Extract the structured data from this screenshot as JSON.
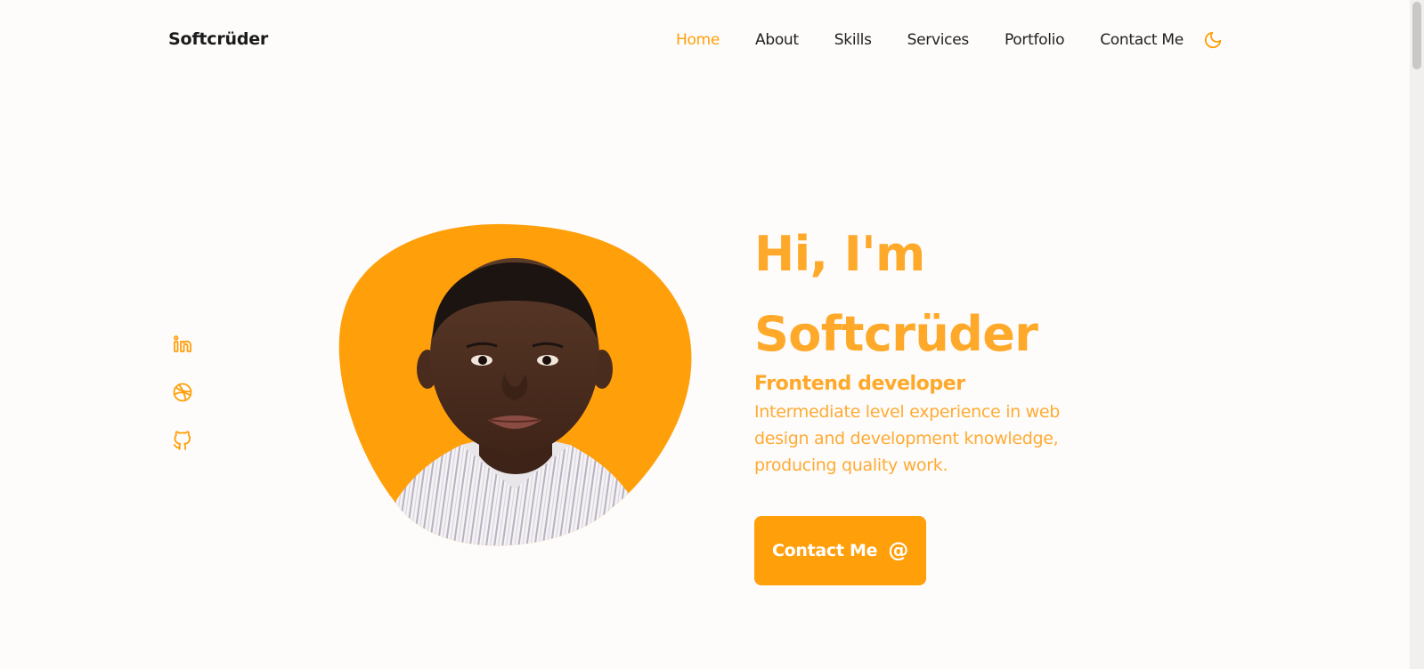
{
  "brand": "Softcrüder",
  "nav": {
    "items": [
      "Home",
      "About",
      "Skills",
      "Services",
      "Portfolio",
      "Contact Me"
    ],
    "active": "Home",
    "theme_toggle_icon": "moon-icon"
  },
  "social": [
    "linkedin-icon",
    "dribbble-icon",
    "github-icon"
  ],
  "hero": {
    "greeting": "Hi, I'm",
    "name": "Softcrüder",
    "role": "Frontend developer",
    "description": "Intermediate level experience in web design and development knowledge, producing quality work.",
    "cta_label": "Contact Me",
    "cta_icon": "@"
  },
  "colors": {
    "accent": "#ff9f0a",
    "text": "#1f1f1f",
    "background": "#fdfcfb"
  }
}
